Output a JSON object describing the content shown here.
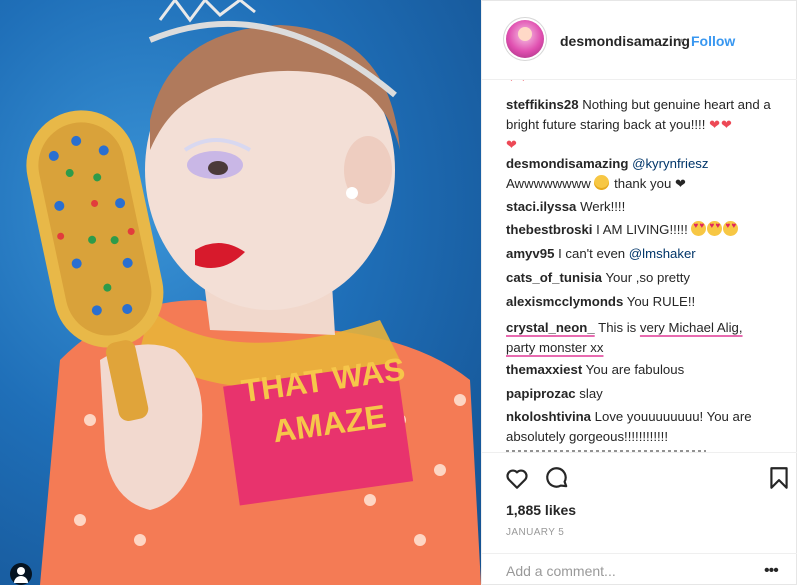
{
  "post": {
    "username": "desmondisamazing",
    "follow_label": "Follow",
    "separator": "•"
  },
  "photo": {
    "sign_line1": "THAT WAS",
    "sign_line2": "AMAZE"
  },
  "comments": [
    {
      "user": "steffikins28",
      "text": "Nothing but genuine heart and a bright future staring back at you!!!!"
    },
    {
      "user": "desmondisamazing",
      "mention": "@kyrynfriesz",
      "text": "Awwwwwwww",
      "text2": "thank you ❤"
    },
    {
      "user": "staci.ilyssa",
      "text": "Werk!!!!"
    },
    {
      "user": "thebestbroski",
      "text": "I AM LIVING!!!!!"
    },
    {
      "user": "amyv95",
      "text": "I can't even",
      "mention": "@lmshaker"
    },
    {
      "user": "cats_of_tunisia",
      "text": "Your ,so pretty"
    },
    {
      "user": "alexismcclymonds",
      "text": "You RULE!!"
    },
    {
      "user": "crystal_neon_",
      "text": "This is",
      "highlight": "very Michael Alig,",
      "highlight2": "party monster xx"
    },
    {
      "user": "themaxxiest",
      "text": "You are fabulous"
    },
    {
      "user": "papiprozac",
      "text": "slay"
    },
    {
      "user": "nkoloshtivina",
      "text": "Love youuuuuuuu! You are absolutely gorgeous!!!!!!!!!!!!"
    }
  ],
  "likes": "1,885 likes",
  "date": "JANUARY 5",
  "add_comment_placeholder": "Add a comment...",
  "icons": {
    "like": "heart-outline-icon",
    "comment": "comment-bubble-icon",
    "save": "bookmark-icon",
    "more": "ellipsis-icon",
    "tag": "user-tag-icon"
  },
  "colors": {
    "follow": "#3897f0",
    "heart": "#ed4956",
    "underline": "#e86bb0",
    "sign": "#e8336d",
    "background_blue": "#1f6fb8"
  }
}
